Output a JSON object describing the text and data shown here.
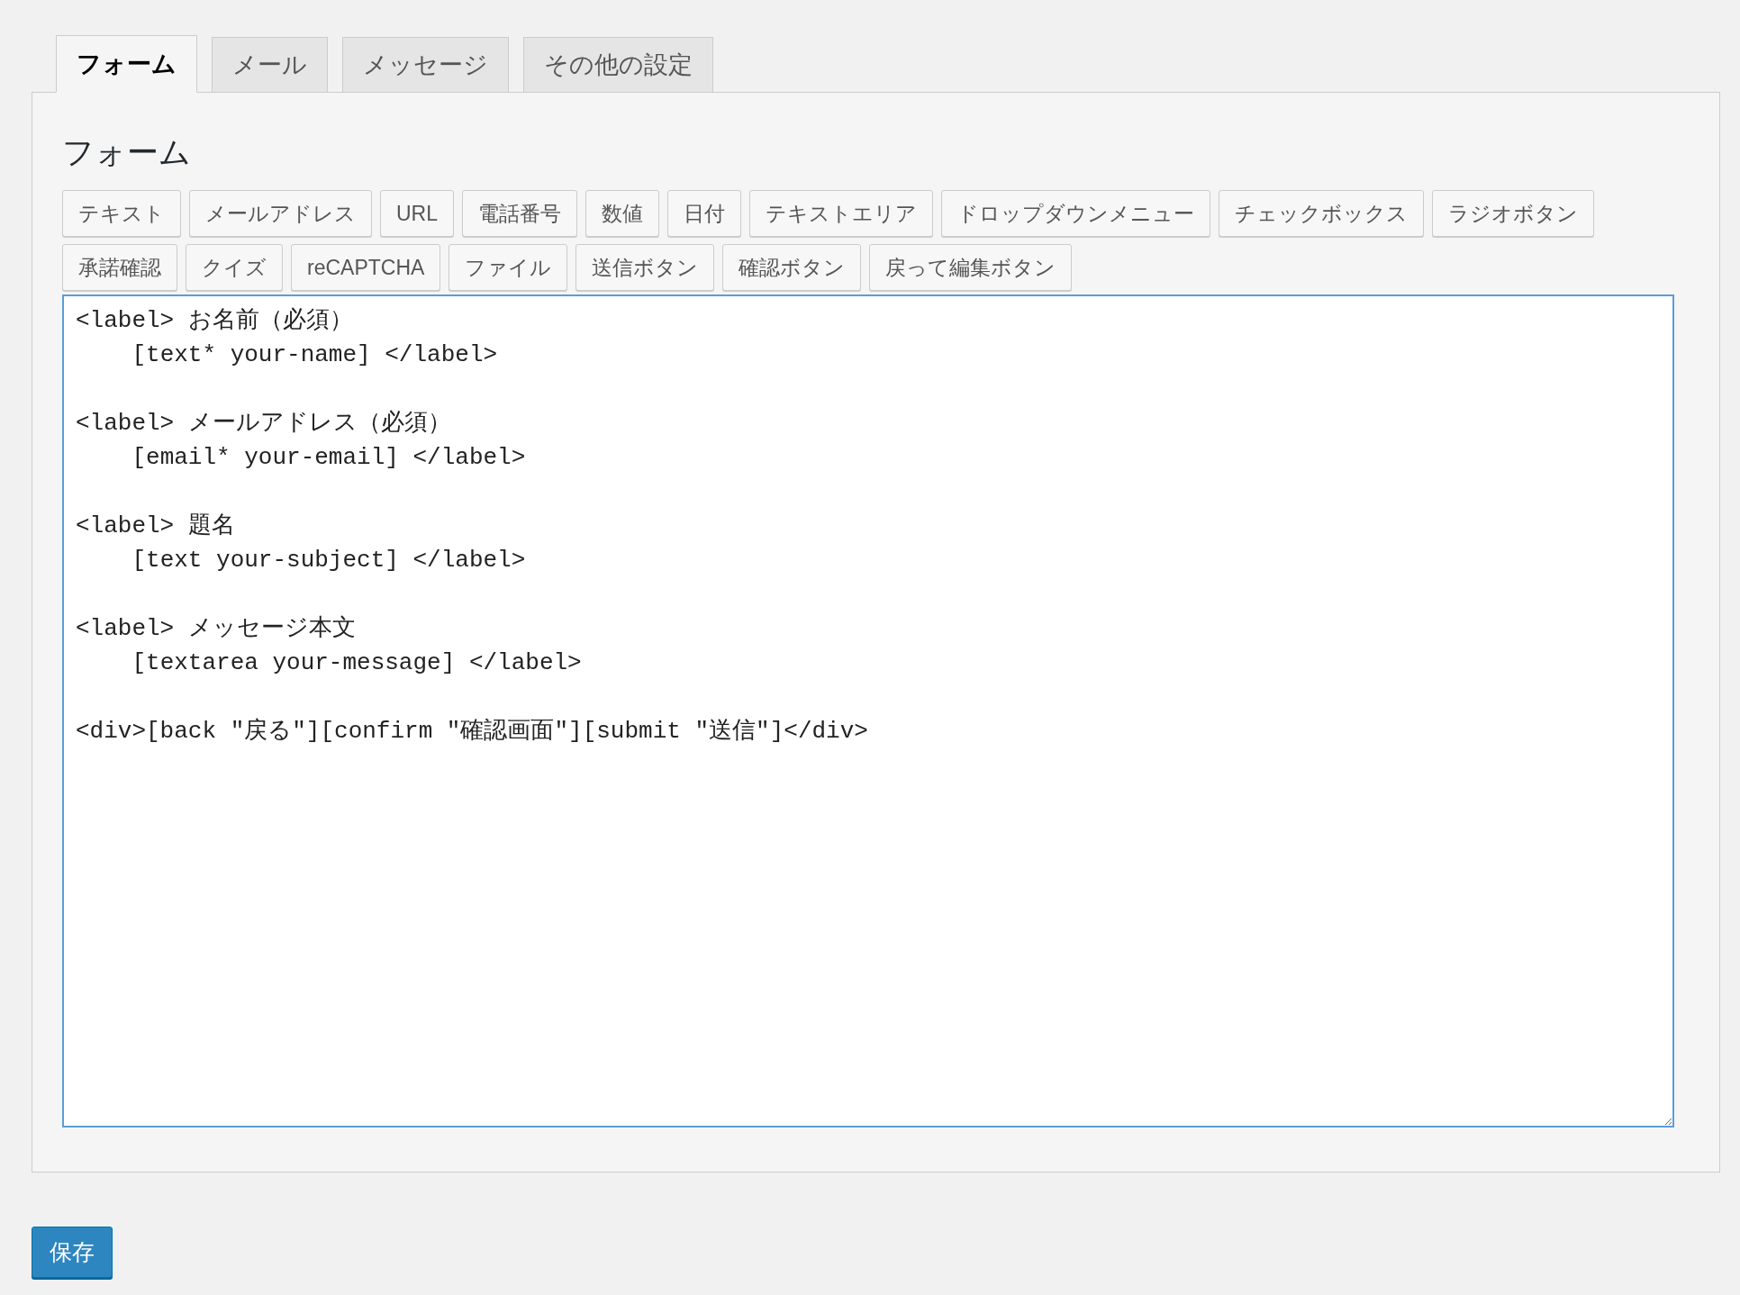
{
  "tabs": [
    {
      "label": "フォーム",
      "selected": true
    },
    {
      "label": "メール",
      "selected": false
    },
    {
      "label": "メッセージ",
      "selected": false
    },
    {
      "label": "その他の設定",
      "selected": false
    }
  ],
  "panel": {
    "heading": "フォーム",
    "tag_buttons": [
      "テキスト",
      "メールアドレス",
      "URL",
      "電話番号",
      "数値",
      "日付",
      "テキストエリア",
      "ドロップダウンメニュー",
      "チェックボックス",
      "ラジオボタン",
      "承諾確認",
      "クイズ",
      "reCAPTCHA",
      "ファイル",
      "送信ボタン",
      "確認ボタン",
      "戻って編集ボタン"
    ],
    "editor": {
      "value": "<label> お名前（必須）\n    [text* your-name] </label>\n\n<label> メールアドレス（必須）\n    [email* your-email] </label>\n\n<label> 題名\n    [text your-subject] </label>\n\n<label> メッセージ本文\n    [textarea your-message] </label>\n\n<div>[back \"戻る\"][confirm \"確認画面\"][submit \"送信\"]</div>",
      "focused": true
    }
  },
  "save_button": "保存"
}
